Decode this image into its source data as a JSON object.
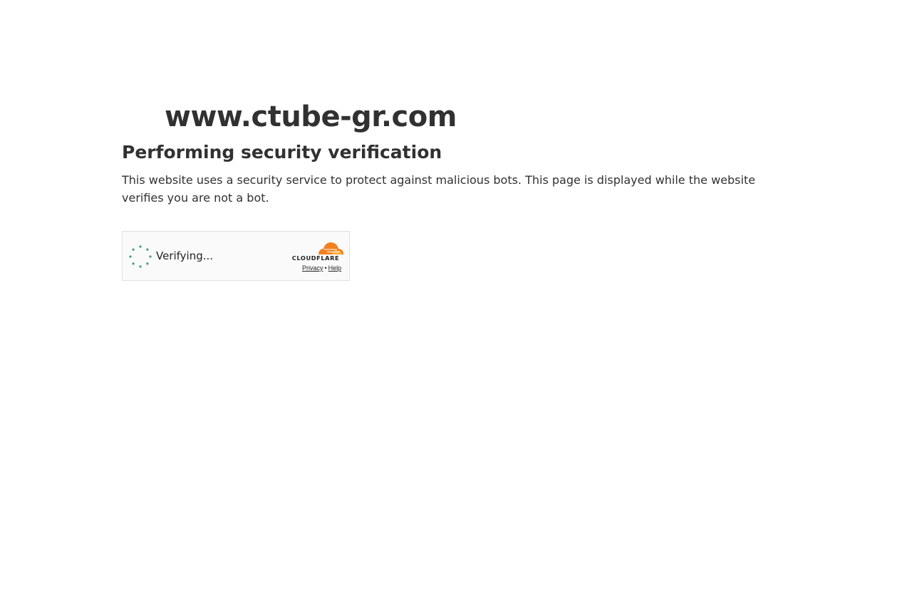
{
  "site": {
    "domain": "www.ctube-gr.com"
  },
  "content": {
    "heading": "Performing security verification",
    "description": "This website uses a security service to protect against malicious bots. This page is displayed while the website verifies you are not a bot."
  },
  "widget": {
    "status_text": "Verifying...",
    "brand_text": "CLOUDFLARE",
    "privacy_link": "Privacy",
    "separator": "•",
    "help_link": "Help",
    "spinner_icon": "loading-spinner-icon",
    "logo_icon": "cloudflare-cloud-icon"
  },
  "colors": {
    "text": "#313131",
    "spinner": "#3fa06b",
    "cloudflare_orange": "#f38020",
    "widget_border": "#e0e0e0",
    "widget_bg": "#fafafa"
  }
}
